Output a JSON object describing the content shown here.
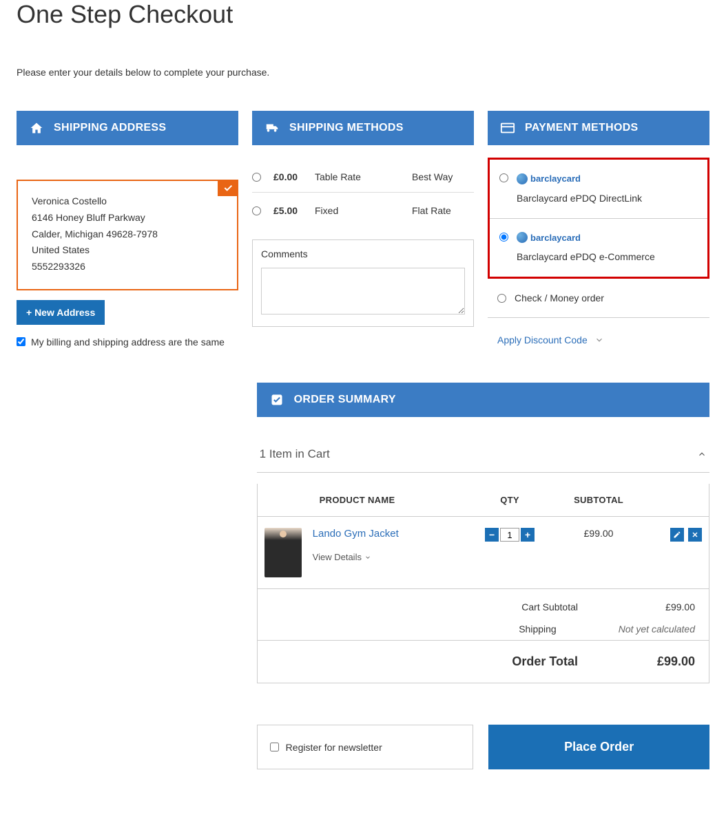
{
  "page": {
    "title": "One Step Checkout",
    "subtitle": "Please enter your details below to complete your purchase."
  },
  "shipping_address": {
    "header": "SHIPPING ADDRESS",
    "name": "Veronica Costello",
    "street": "6146 Honey Bluff Parkway",
    "city_region_zip": "Calder, Michigan 49628-7978",
    "country": "United States",
    "phone": "5552293326",
    "new_address_label": "+ New Address",
    "billing_same_label": "My billing and shipping address are the same",
    "billing_same_checked": true
  },
  "shipping_methods": {
    "header": "SHIPPING METHODS",
    "methods": [
      {
        "price": "£0.00",
        "name": "Table Rate",
        "carrier": "Best Way",
        "selected": false
      },
      {
        "price": "£5.00",
        "name": "Fixed",
        "carrier": "Flat Rate",
        "selected": false
      }
    ],
    "comments_label": "Comments",
    "comments_value": ""
  },
  "payment_methods": {
    "header": "PAYMENT METHODS",
    "barclay_logo_text": "barclaycard",
    "methods": [
      {
        "label": "Barclaycard ePDQ DirectLink",
        "selected": false,
        "logo": true
      },
      {
        "label": "Barclaycard ePDQ e-Commerce",
        "selected": true,
        "logo": true
      },
      {
        "label": "Check / Money order",
        "selected": false,
        "logo": false
      }
    ],
    "discount_label": "Apply Discount Code"
  },
  "order_summary": {
    "header": "ORDER SUMMARY",
    "cart_count_text": "1 Item in Cart",
    "columns": {
      "product": "PRODUCT NAME",
      "qty": "QTY",
      "subtotal": "SUBTOTAL"
    },
    "items": [
      {
        "name": "Lando Gym Jacket",
        "view_details": "View Details",
        "qty": "1",
        "subtotal": "£99.00"
      }
    ],
    "totals": {
      "cart_subtotal_label": "Cart Subtotal",
      "cart_subtotal_value": "£99.00",
      "shipping_label": "Shipping",
      "shipping_value": "Not yet calculated",
      "order_total_label": "Order Total",
      "order_total_value": "£99.00"
    }
  },
  "footer": {
    "newsletter_label": "Register for newsletter",
    "newsletter_checked": false,
    "place_order_label": "Place Order"
  }
}
